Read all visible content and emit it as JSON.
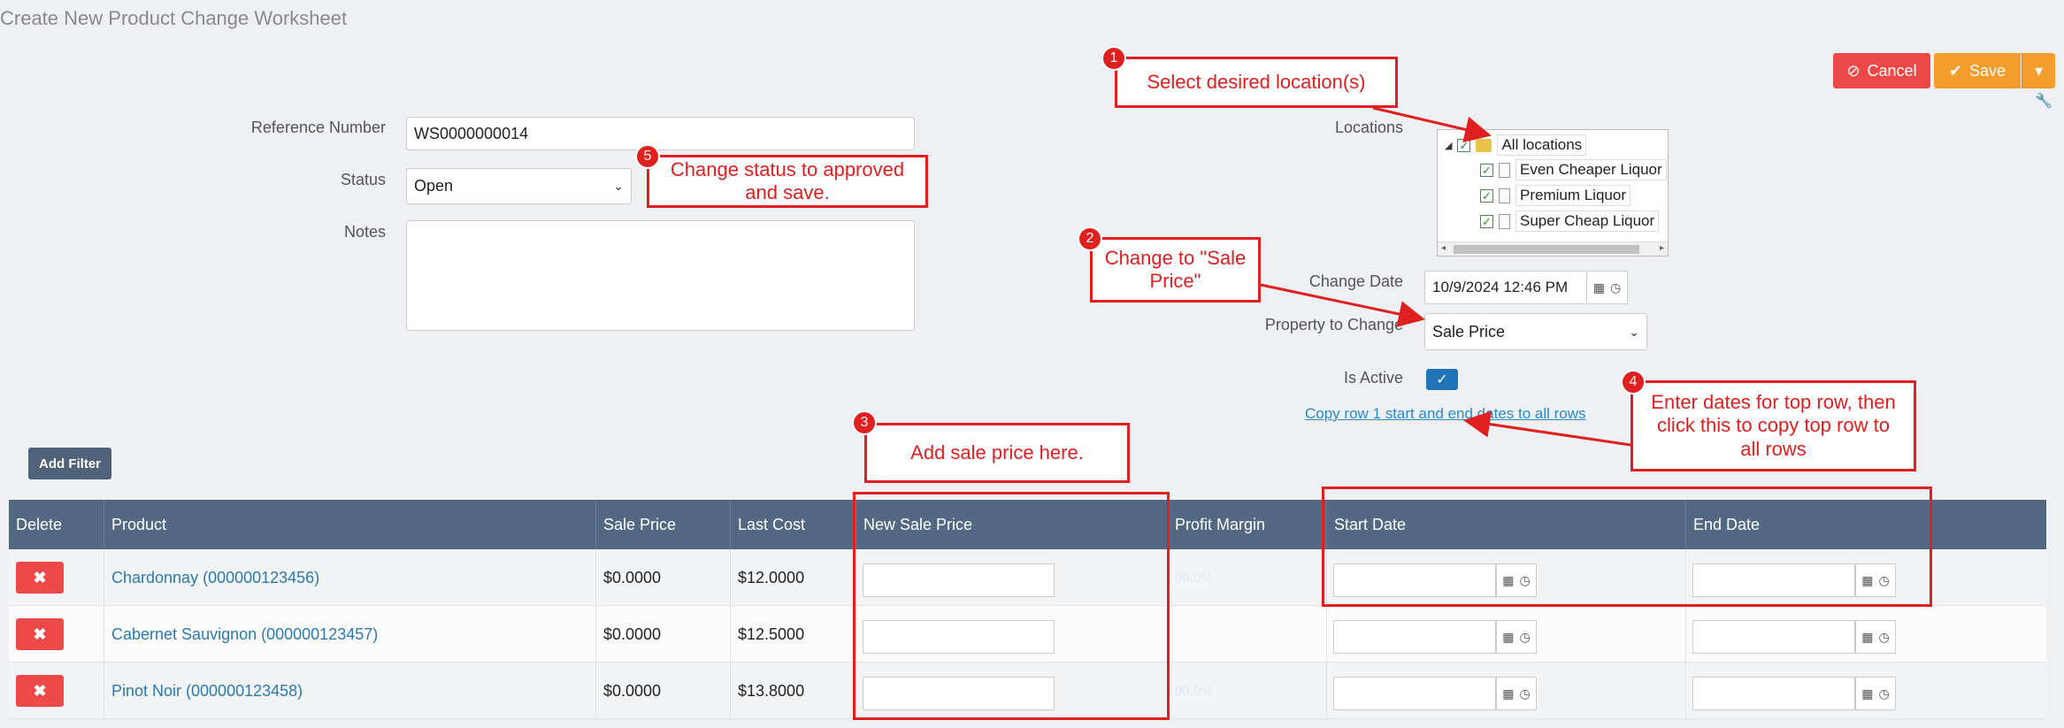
{
  "page": {
    "title": "Create New Product Change Worksheet"
  },
  "toolbar": {
    "cancel_label": "Cancel",
    "save_label": "Save"
  },
  "form": {
    "reference_label": "Reference Number",
    "reference_value": "WS0000000014",
    "status_label": "Status",
    "status_value": "Open",
    "notes_label": "Notes",
    "notes_value": "",
    "locations_label": "Locations",
    "locations": [
      {
        "label": "All locations",
        "checked": true
      },
      {
        "label": "Even Cheaper Liquor",
        "checked": true
      },
      {
        "label": "Premium Liquor",
        "checked": true
      },
      {
        "label": "Super Cheap Liquor",
        "checked": true
      }
    ],
    "change_date_label": "Change Date",
    "change_date_value": "10/9/2024 12:46 PM",
    "property_label": "Property to Change",
    "property_value": "Sale Price",
    "is_active_label": "Is Active",
    "is_active": true,
    "copy_link": "Copy row 1 start and end dates to all rows"
  },
  "filter": {
    "add_filter_label": "Add Filter"
  },
  "table": {
    "columns": [
      "Delete",
      "Product",
      "Sale Price",
      "Last Cost",
      "New Sale Price",
      "Profit Margin",
      "Start Date",
      "End Date"
    ],
    "rows": [
      {
        "product": "Chardonnay (000000123456)",
        "sale_price": "$0.0000",
        "last_cost": "$12.0000",
        "margin": "00.0%"
      },
      {
        "product": "Cabernet Sauvignon (000000123457)",
        "sale_price": "$0.0000",
        "last_cost": "$12.5000",
        "margin": ""
      },
      {
        "product": "Pinot Noir (000000123458)",
        "sale_price": "$0.0000",
        "last_cost": "$13.8000",
        "margin": "00.0%"
      }
    ]
  },
  "annotations": {
    "c1": {
      "num": "1",
      "text": "Select desired location(s)"
    },
    "c2": {
      "num": "2",
      "text": "Change to \"Sale Price\""
    },
    "c3": {
      "num": "3",
      "text": "Add sale price here."
    },
    "c4": {
      "num": "4",
      "text": "Enter dates for top row, then click this to copy top row to all rows"
    },
    "c5": {
      "num": "5",
      "text": "Change status to approved and save."
    }
  },
  "colors": {
    "accent_red": "#e01f1f",
    "header": "#536882",
    "link": "#2a8bc4",
    "save": "#f29d2c",
    "cancel": "#ee4949"
  }
}
